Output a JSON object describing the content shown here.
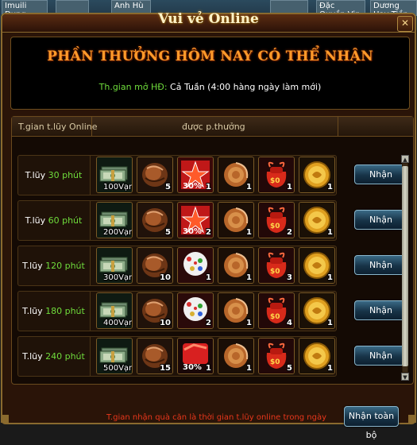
{
  "background_tabs": [
    "Imuili Dụng",
    "",
    "Anh Hù",
    "",
    "Đặc Quyền Vip",
    "Dương Hay Tiền Thế Giới"
  ],
  "window": {
    "title": "Vui vẻ Online",
    "close_label": "✕"
  },
  "header": {
    "heading": "PHẦN THƯỞNG HÔM NAY CÓ THỂ NHẬN",
    "time_label": "Th.gian mở HĐ:",
    "time_value": "Cả Tuần (4:00 hàng ngày làm mới)"
  },
  "table": {
    "col_time": "T.gian t.lũy Online",
    "col_reward": "được p.thưởng",
    "rows": [
      {
        "label_prefix": "T.lũy ",
        "minutes": "30 phút",
        "button": "Nhận",
        "items": [
          {
            "icon": "money-bundle-icon",
            "qty": "100Vạn"
          },
          {
            "icon": "wood-log-icon",
            "qty": "5"
          },
          {
            "icon": "star-card-icon",
            "qty": "1",
            "tag": "30%"
          },
          {
            "icon": "scroll-icon",
            "qty": "1"
          },
          {
            "icon": "gift-bag-icon",
            "qty": "1"
          },
          {
            "icon": "gold-coin-icon",
            "qty": "1"
          }
        ]
      },
      {
        "label_prefix": "T.lũy ",
        "minutes": "60 phút",
        "button": "Nhận",
        "items": [
          {
            "icon": "money-bundle-icon",
            "qty": "200Vạn"
          },
          {
            "icon": "wood-log-icon",
            "qty": "5"
          },
          {
            "icon": "star-card-icon",
            "qty": "2",
            "tag": "30%"
          },
          {
            "icon": "scroll-icon",
            "qty": "1"
          },
          {
            "icon": "gift-bag-icon",
            "qty": "2"
          },
          {
            "icon": "gold-coin-icon",
            "qty": "1"
          }
        ]
      },
      {
        "label_prefix": "T.lũy ",
        "minutes": "120 phút",
        "button": "Nhận",
        "items": [
          {
            "icon": "money-bundle-icon",
            "qty": "300Vạn"
          },
          {
            "icon": "wood-log-icon",
            "qty": "10"
          },
          {
            "icon": "flower-icon",
            "qty": "1"
          },
          {
            "icon": "scroll-icon",
            "qty": "1"
          },
          {
            "icon": "gift-bag-icon",
            "qty": "3"
          },
          {
            "icon": "gold-coin-icon",
            "qty": "1"
          }
        ]
      },
      {
        "label_prefix": "T.lũy ",
        "minutes": "180 phút",
        "button": "Nhận",
        "items": [
          {
            "icon": "money-bundle-icon",
            "qty": "400Vạn"
          },
          {
            "icon": "wood-log-icon",
            "qty": "10"
          },
          {
            "icon": "flower-icon",
            "qty": "2"
          },
          {
            "icon": "scroll-icon",
            "qty": "1"
          },
          {
            "icon": "gift-bag-icon",
            "qty": "4"
          },
          {
            "icon": "gold-coin-icon",
            "qty": "1"
          }
        ]
      },
      {
        "label_prefix": "T.lũy ",
        "minutes": "240 phút",
        "button": "Nhận",
        "items": [
          {
            "icon": "money-bundle-icon",
            "qty": "500Vạn"
          },
          {
            "icon": "wood-log-icon",
            "qty": "15"
          },
          {
            "icon": "red-card-icon",
            "qty": "1",
            "tag": "30%"
          },
          {
            "icon": "scroll-icon",
            "qty": "1"
          },
          {
            "icon": "gift-bag-icon",
            "qty": "5"
          },
          {
            "icon": "gold-coin-icon",
            "qty": "1"
          }
        ]
      }
    ]
  },
  "footer": {
    "note": "T.gian nhận quà căn là thời gian t.lũy online trong ngày",
    "claim_all": "Nhận toàn bộ"
  },
  "colors": {
    "accent_orange": "#ff9a2a",
    "green": "#6fdc3c",
    "note_red": "#e8371c",
    "border_gold": "#8a6a2e"
  }
}
